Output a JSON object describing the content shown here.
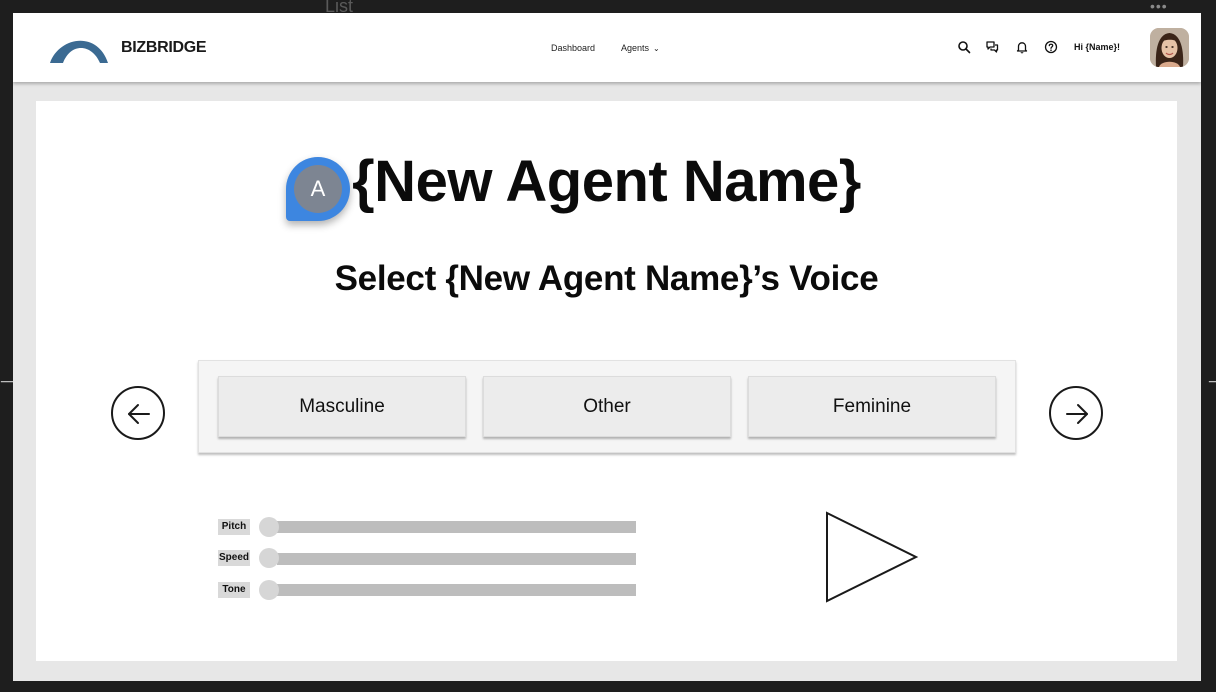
{
  "canvas": {
    "frame_title": "List",
    "dots": "•••"
  },
  "header": {
    "brand": "BIZBRIDGE",
    "nav": {
      "dashboard": "Dashboard",
      "agents": "Agents",
      "agents_chevron": "⌄"
    },
    "icons": [
      "search-icon",
      "chat-icon",
      "bell-icon",
      "help-icon"
    ],
    "greeting": "Hi {Name}!",
    "logo_color": "#3b6a92"
  },
  "main": {
    "title": "{New Agent Name}",
    "subtitle": "Select {New Agent Name}’s Voice",
    "comment_initial": "A",
    "voice_options": [
      {
        "label": "Masculine"
      },
      {
        "label": "Other"
      },
      {
        "label": "Feminine"
      }
    ],
    "sliders": [
      {
        "label": "Pitch",
        "value": 0
      },
      {
        "label": "Speed",
        "value": 0
      },
      {
        "label": "Tone",
        "value": 0
      }
    ]
  },
  "colors": {
    "comment_pin": "#3d86e0",
    "track": "#bdbdbd",
    "background": "#e7e7e7"
  }
}
